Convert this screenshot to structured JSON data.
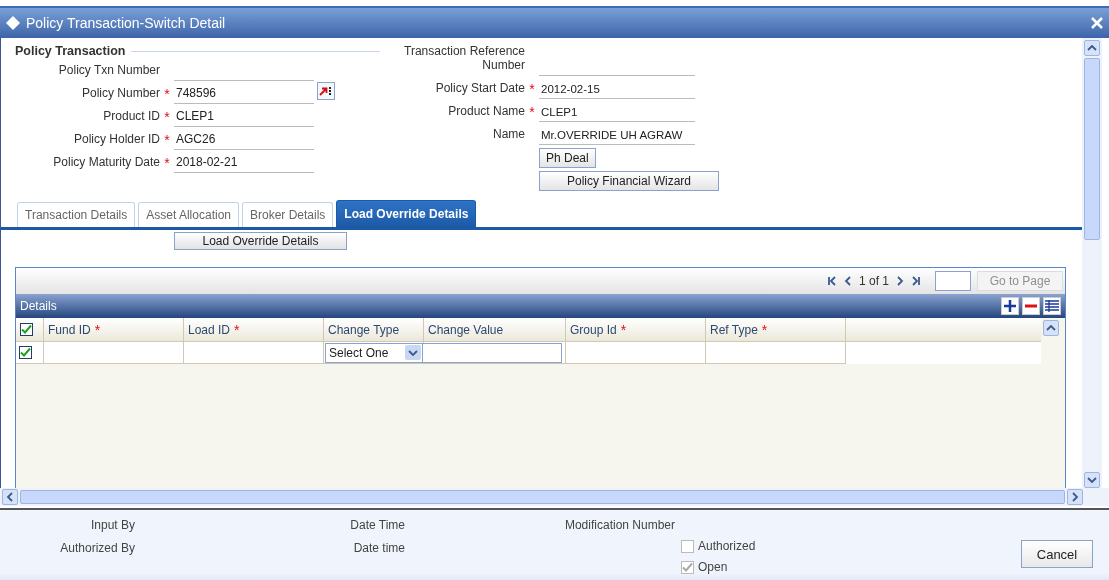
{
  "window": {
    "title": "Policy Transaction-Switch Detail"
  },
  "section": {
    "legend": "Policy Transaction"
  },
  "left_fields": [
    {
      "label": "Policy Txn Number",
      "kind": "text"
    },
    {
      "label": "Policy Number",
      "mark": "*",
      "kind": "lookup",
      "value": "748596"
    },
    {
      "label": "Product ID",
      "mark": "*",
      "kind": "text",
      "value": "CLEP1"
    },
    {
      "label": "Policy Holder ID",
      "mark": "*",
      "kind": "text",
      "value": "AGC26"
    },
    {
      "label": "Policy Maturity Date",
      "mark": "*",
      "kind": "text",
      "value": "2018-02-21"
    }
  ],
  "right_fields": [
    {
      "label": "Transaction Reference Number"
    },
    {
      "label": "Policy Start Date",
      "mark": "*",
      "value": "2012-02-15"
    },
    {
      "label": "Product Name",
      "mark": "*",
      "value": "CLEP1"
    },
    {
      "label": "Name",
      "value": "Mr.OVERRIDE UH AGRAW"
    }
  ],
  "header_buttons": [
    "Ph Deal",
    "Policy Financial Wizard"
  ],
  "tabs": [
    {
      "label": "Transaction Details",
      "selected": false
    },
    {
      "label": "Asset Allocation",
      "selected": false
    },
    {
      "label": "Broker Details",
      "selected": false
    },
    {
      "label": "Load Override Details",
      "selected": true
    }
  ],
  "sub_button": "Load Override Details",
  "grid": {
    "pager": "1 of 1",
    "go_button": {
      "label": "Go to Page",
      "disabled": true
    },
    "title": "Details",
    "select_all": true,
    "columns": [
      {
        "label": "Fund ID",
        "mark": "*"
      },
      {
        "label": "Load ID",
        "mark": "*"
      },
      {
        "label": "Change Type"
      },
      {
        "label": "Change Value"
      },
      {
        "label": "Group Id",
        "mark": "*"
      },
      {
        "label": "Ref Type",
        "mark": "*"
      }
    ],
    "rows": [
      {
        "checked": true,
        "cells": [
          {
            "kind": "text"
          },
          {
            "kind": "text"
          },
          {
            "kind": "select",
            "value": "Select One"
          },
          {
            "kind": "input"
          },
          {
            "kind": "text"
          },
          {
            "kind": "text"
          }
        ]
      }
    ]
  },
  "footer": {
    "labels": [
      [
        "Input By",
        "Authorized By"
      ],
      [
        "Date Time",
        "Date time"
      ],
      [
        "Modification Number"
      ]
    ],
    "checkboxes": [
      {
        "label": "Authorized",
        "checked": false,
        "disabled": true
      },
      {
        "label": "Open",
        "checked": true,
        "disabled": true
      }
    ],
    "cancel": "Cancel"
  }
}
